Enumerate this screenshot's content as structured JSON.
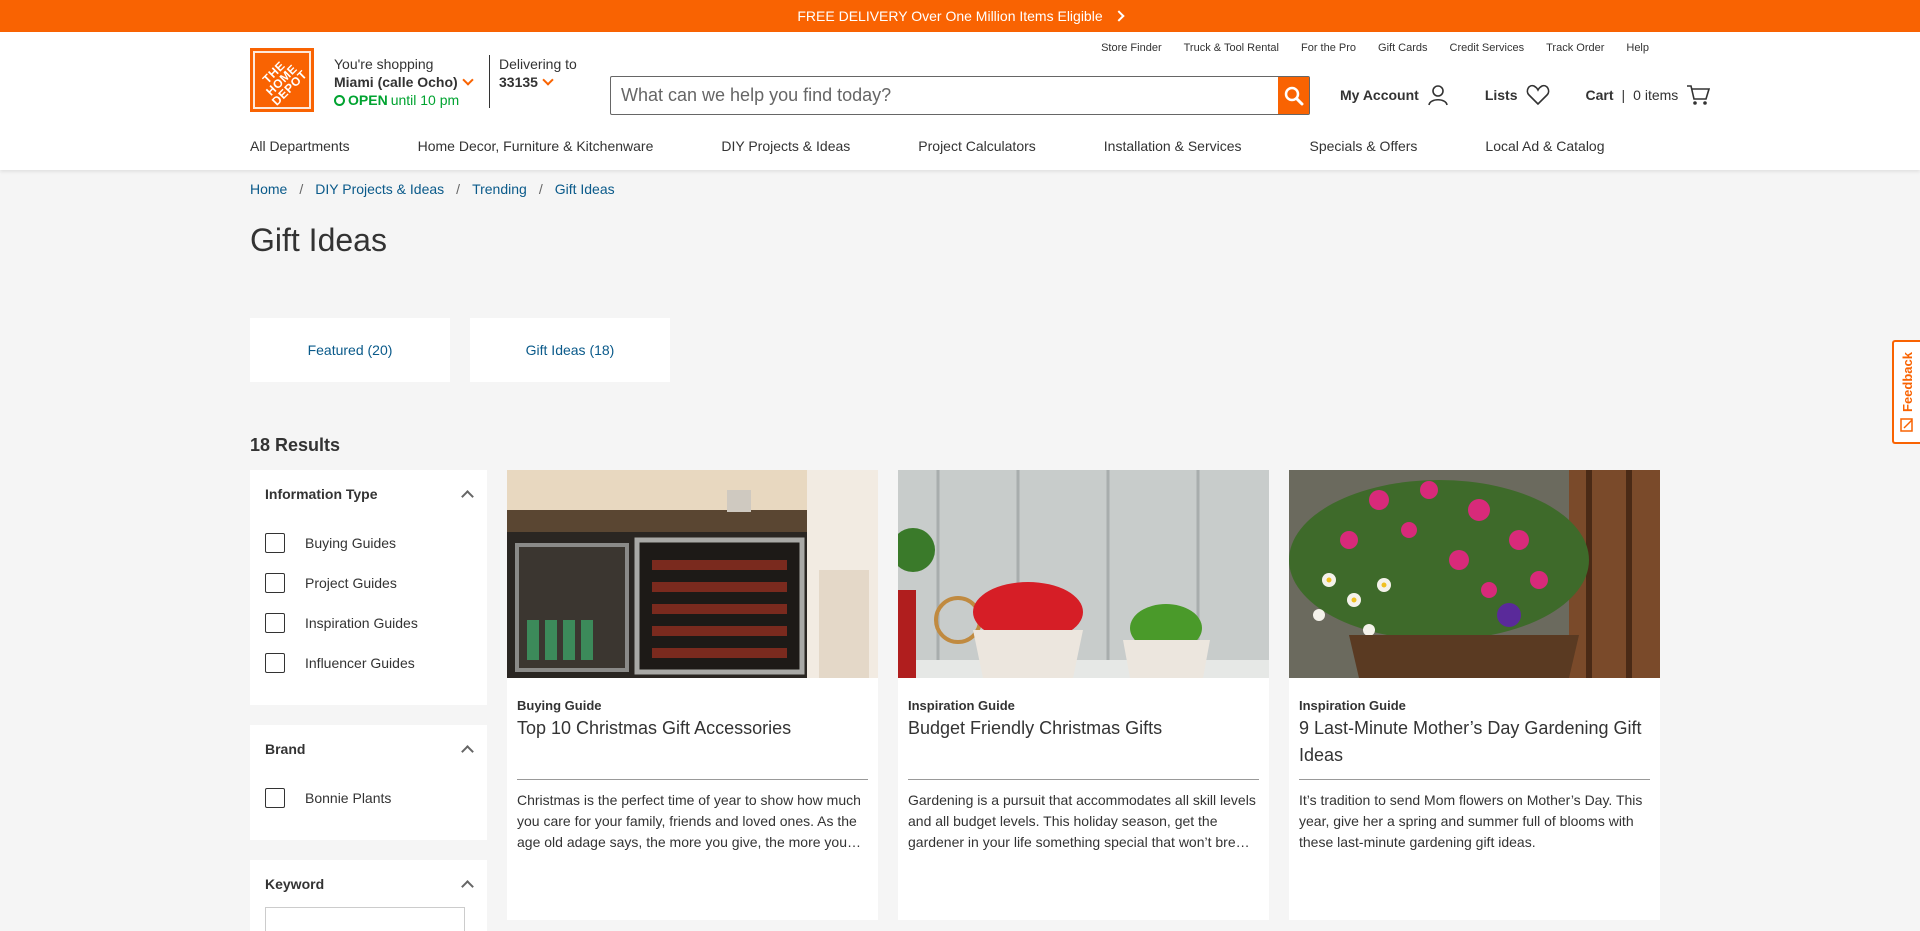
{
  "promo": {
    "text": "FREE DELIVERY Over One Million Items Eligible"
  },
  "logo": {
    "text": "THE HOME DEPOT"
  },
  "store": {
    "label": "You're shopping",
    "name": "Miami (calle Ocho)",
    "open": "OPEN",
    "hours": "until 10 pm"
  },
  "delivery": {
    "label": "Delivering to",
    "zip": "33135"
  },
  "utility": [
    "Store Finder",
    "Truck & Tool Rental",
    "For the Pro",
    "Gift Cards",
    "Credit Services",
    "Track Order",
    "Help"
  ],
  "search": {
    "placeholder": "What can we help you find today?"
  },
  "account": {
    "account_label": "My Account",
    "lists_label": "Lists",
    "cart_label": "Cart",
    "cart_sep": "|",
    "cart_count": "0 items"
  },
  "nav": [
    "All Departments",
    "Home Decor, Furniture & Kitchenware",
    "DIY Projects & Ideas",
    "Project Calculators",
    "Installation & Services",
    "Specials & Offers",
    "Local Ad & Catalog"
  ],
  "breadcrumb": [
    "Home",
    "DIY Projects & Ideas",
    "Trending",
    "Gift Ideas"
  ],
  "page_title": "Gift Ideas",
  "tabs": [
    {
      "label": "Featured (20)"
    },
    {
      "label": "Gift Ideas (18)"
    }
  ],
  "results_label": "18 Results",
  "facets": {
    "info_type": {
      "title": "Information Type",
      "options": [
        "Buying Guides",
        "Project Guides",
        "Inspiration Guides",
        "Influencer Guides"
      ]
    },
    "brand": {
      "title": "Brand",
      "options": [
        "Bonnie Plants"
      ]
    },
    "keyword": {
      "title": "Keyword"
    }
  },
  "cards": [
    {
      "type": "Buying Guide",
      "title": "Top 10 Christmas Gift Accessories",
      "desc": "Christmas is the perfect time of year to show how much you care for your family, friends and loved ones. As the age old adage says, the more you give, the more you…"
    },
    {
      "type": "Inspiration Guide",
      "title": "Budget Friendly Christmas Gifts",
      "desc": "Gardening is a pursuit that accommodates all skill levels and all budget levels. This holiday season, get the gardener in your life something special that won’t bre…"
    },
    {
      "type": "Inspiration Guide",
      "title": "9 Last-Minute Mother’s Day Gardening Gift Ideas",
      "desc": "It’s tradition to send Mom flowers on Mother’s Day. This year, give her a spring and summer full of blooms with these last-minute gardening gift ideas."
    }
  ],
  "feedback": "Feedback",
  "colors": {
    "brand": "#f96302",
    "link": "#0a5a8a",
    "open": "#00a330"
  }
}
